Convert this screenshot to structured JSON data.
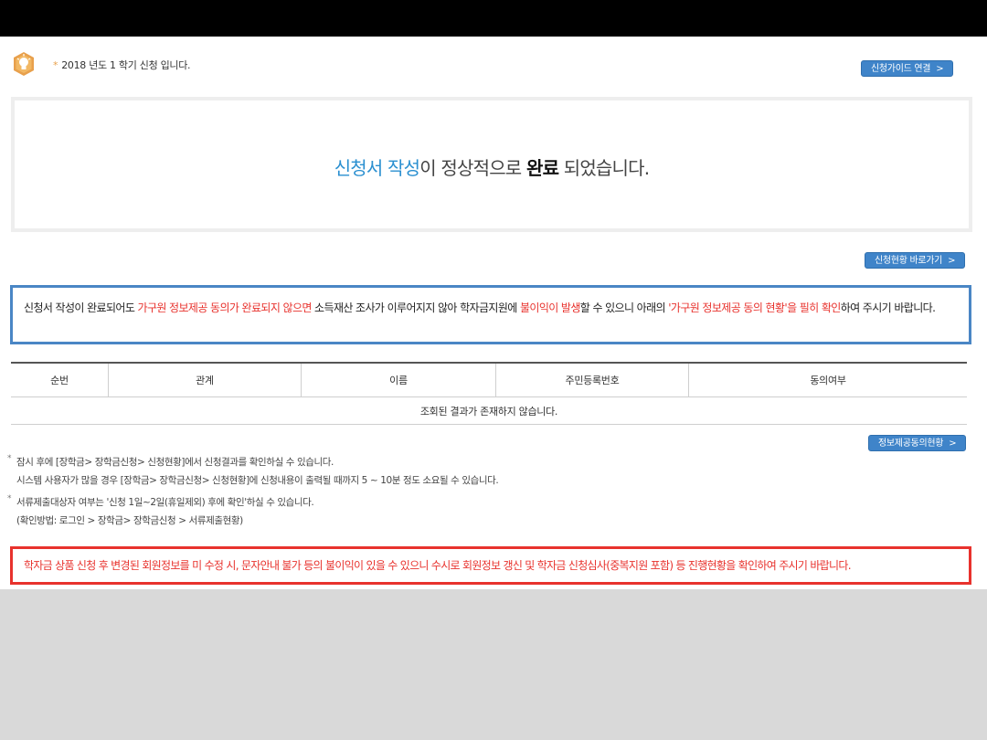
{
  "semester": {
    "text": "2018 년도 1 학기 신청 입니다.",
    "guide_button": "신청가이드 연결"
  },
  "completion": {
    "part1": "신청서 작성",
    "part2": "이 정상적으로 ",
    "part3": "완료",
    "part4": " 되었습니다."
  },
  "status_button": "신청현황 바로가기",
  "notice": {
    "p1": "신청서 작성이 완료되어도 ",
    "p2": "가구원 정보제공 동의가 완료되지 않으면",
    "p3": " 소득재산 조사가 이루어지지 않아 학자금지원에 ",
    "p4": "불이익이 발생",
    "p5": "할 수 있으니 아래의 ",
    "p6": "'가구원 정보제공 동의 현황'을 필히 확인",
    "p7": "하여 주시기 바랍니다."
  },
  "table": {
    "headers": [
      "순번",
      "관계",
      "이름",
      "주민등록번호",
      "동의여부"
    ],
    "empty_message": "조회된 결과가 존재하지 않습니다."
  },
  "consent_button": "정보제공동의현황",
  "info": {
    "line1": "잠시 후에 [장학금> 장학금신청> 신청현황]에서 신청결과를 확인하실 수 있습니다.",
    "line2": "시스템 사용자가 많을 경우 [장학금> 장학금신청> 신청현황]에 신청내용이 출력될 때까지 5 ~ 10분 정도 소요될 수 있습니다.",
    "line3": "서류제출대상자 여부는 '신청 1일~2일(휴일제외) 후에 확인'하실 수 있습니다.",
    "line4": "(확인방법: 로그인 > 장학금> 장학금신청 > 서류제출현황)"
  },
  "warning": "학자금 상품 신청 후 변경된 회원정보를 미 수정 시, 문자안내 불가 등의 불이익이 있을 수 있으니 수시로 회원정보 갱신 및 학자금 신청심사(중복지원 포함) 등 진행현황을 확인하여 주시기 바랍니다.",
  "icons": {
    "bulb": "lightbulb-icon",
    "chevron": "chevron-right-icon"
  },
  "colors": {
    "accent_blue": "#3f84c9",
    "alert_red": "#e8322d",
    "bulb_orange": "#e8a04c"
  }
}
